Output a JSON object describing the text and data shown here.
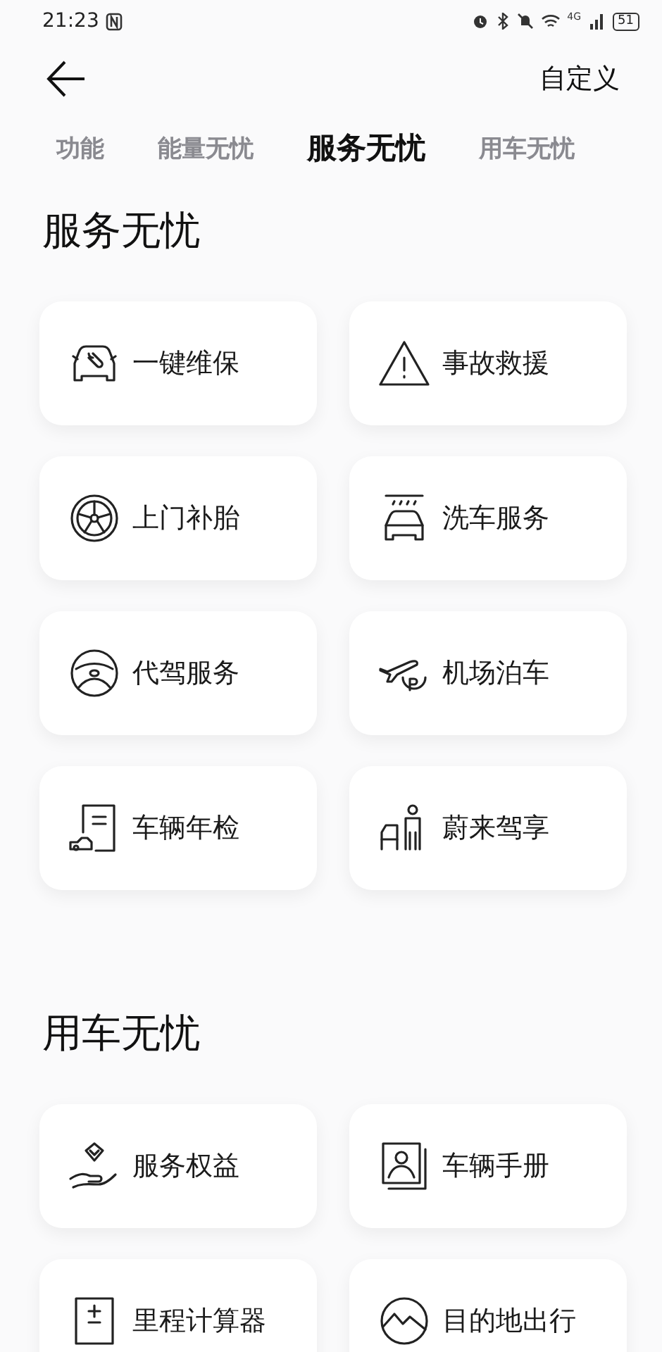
{
  "status_bar": {
    "time": "21:23",
    "network": "4G",
    "battery": "51"
  },
  "header": {
    "action": "自定义"
  },
  "tabs": [
    {
      "label": "功能",
      "selected": false
    },
    {
      "label": "能量无忧",
      "selected": false
    },
    {
      "label": "服务无忧",
      "selected": true
    },
    {
      "label": "用车无忧",
      "selected": false
    }
  ],
  "sections": [
    {
      "title": "服务无忧",
      "items": [
        {
          "label": "一键维保"
        },
        {
          "label": "事故救援"
        },
        {
          "label": "上门补胎"
        },
        {
          "label": "洗车服务"
        },
        {
          "label": "代驾服务"
        },
        {
          "label": "机场泊车"
        },
        {
          "label": "车辆年检"
        },
        {
          "label": "蔚来驾享"
        }
      ]
    },
    {
      "title": "用车无忧",
      "items": [
        {
          "label": "服务权益"
        },
        {
          "label": "车辆手册"
        },
        {
          "label": "里程计算器"
        },
        {
          "label": "目的地出行"
        }
      ]
    }
  ]
}
